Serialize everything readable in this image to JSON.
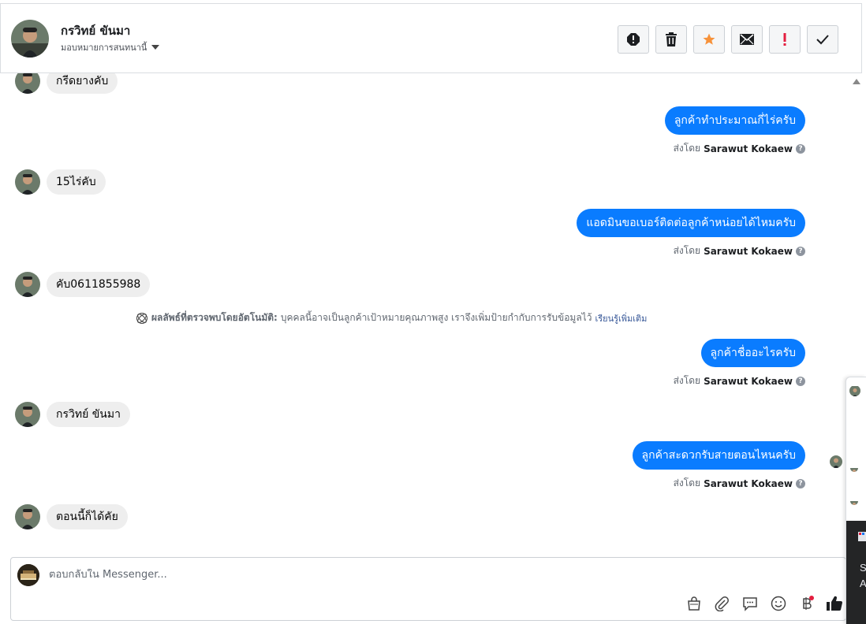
{
  "header": {
    "name": "กรวิทย์ ขันมา",
    "assign_label": "มอบหมายการสนทนานี้"
  },
  "toolbar": {
    "spam": "spam-icon",
    "delete": "trash-icon",
    "star": "star-icon",
    "mark_unread": "envelope-icon",
    "follow_up": "exclamation-icon",
    "done": "check-icon"
  },
  "messages": {
    "m1": "กรีดยางคับ",
    "m2": "ลูกค้าทำประมาณกี่ไร่ครับ",
    "m3": "15ไร่คับ",
    "m4": "แอดมินขอเบอร์ติดต่อลูกค้าหน่อยได้ไหมครับ",
    "m5": "คับ0611855988",
    "m6": "ลูกค้าชื่ออะไรครับ",
    "m7": "กรวิทย์  ขันมา",
    "m8": "ลูกค้าสะดวกรับสายตอนไหนครับ",
    "m9": "ตอนนี้ก็ได้คัย"
  },
  "sent_by": {
    "prefix": "ส่งโดย",
    "agent": "Sarawut Kokaew"
  },
  "auto_note": {
    "title": "ผลลัพธ์ที่ตรวจพบโดยอัตโนมัติ:",
    "text": "บุคคลนี้อาจเป็นลูกค้าเป้าหมายคุณภาพสูง เราจึงเพิ่มป้ายกำกับการรับข้อมูลไว้",
    "link": "เรียนรู้เพิ่มเติม"
  },
  "composer": {
    "placeholder": "ตอบกลับใน Messenger...",
    "icons": [
      "shopping-bag-icon",
      "paperclip-icon",
      "saved-reply-icon",
      "emoji-icon",
      "baht-payment-icon",
      "thumbs-up-icon"
    ]
  },
  "side_panel": {
    "line1": "S",
    "line2": "A"
  },
  "colors": {
    "outgoing_bubble": "#0a7cff",
    "incoming_bubble": "#eeeeee",
    "star": "#f7923a",
    "follow_up": "#e41e3f"
  }
}
